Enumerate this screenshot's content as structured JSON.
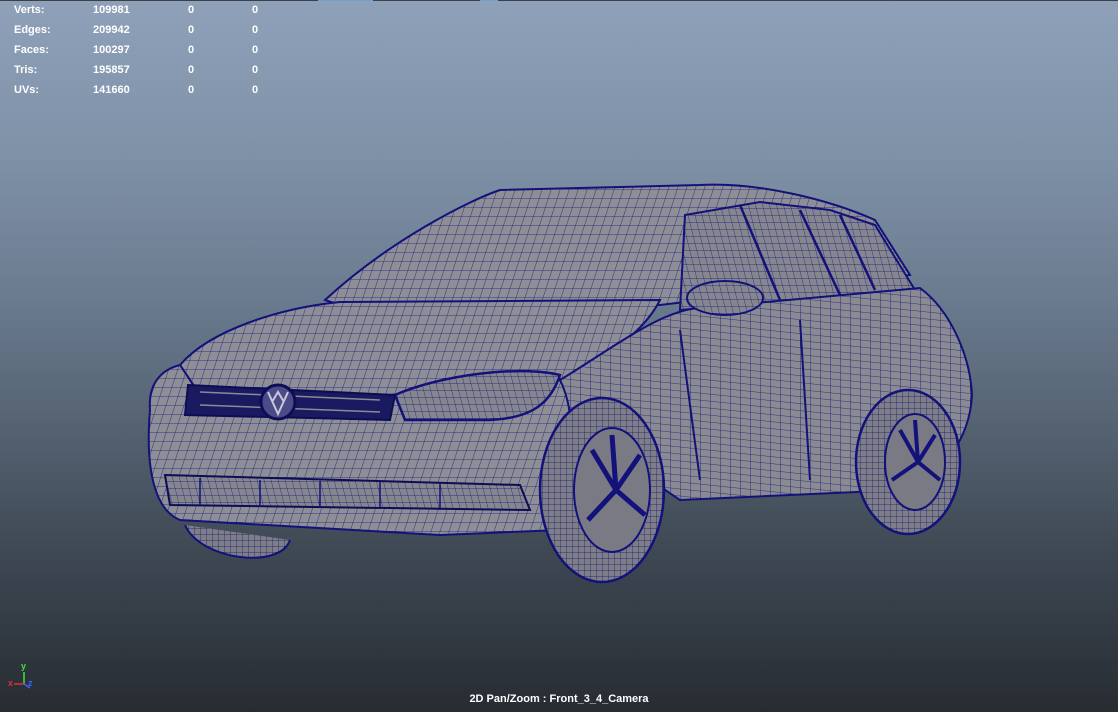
{
  "hud": {
    "rows": [
      {
        "label": "Verts:",
        "total": "109981",
        "selected": "0",
        "uv": "0"
      },
      {
        "label": "Edges:",
        "total": "209942",
        "selected": "0",
        "uv": "0"
      },
      {
        "label": "Faces:",
        "total": "100297",
        "selected": "0",
        "uv": "0"
      },
      {
        "label": "Tris:",
        "total": "195857",
        "selected": "0",
        "uv": "0"
      },
      {
        "label": "UVs:",
        "total": "141660",
        "selected": "0",
        "uv": "0"
      }
    ]
  },
  "viewport": {
    "camera_label": "2D Pan/Zoom : Front_3_4_Camera",
    "model": "car-wireframe",
    "wire_color": "#14147a",
    "surface_color": "#8d8d94"
  },
  "axis": {
    "x": "x",
    "y": "y",
    "z": "z",
    "x_color": "#e03030",
    "y_color": "#40e040",
    "z_color": "#4060ff"
  }
}
